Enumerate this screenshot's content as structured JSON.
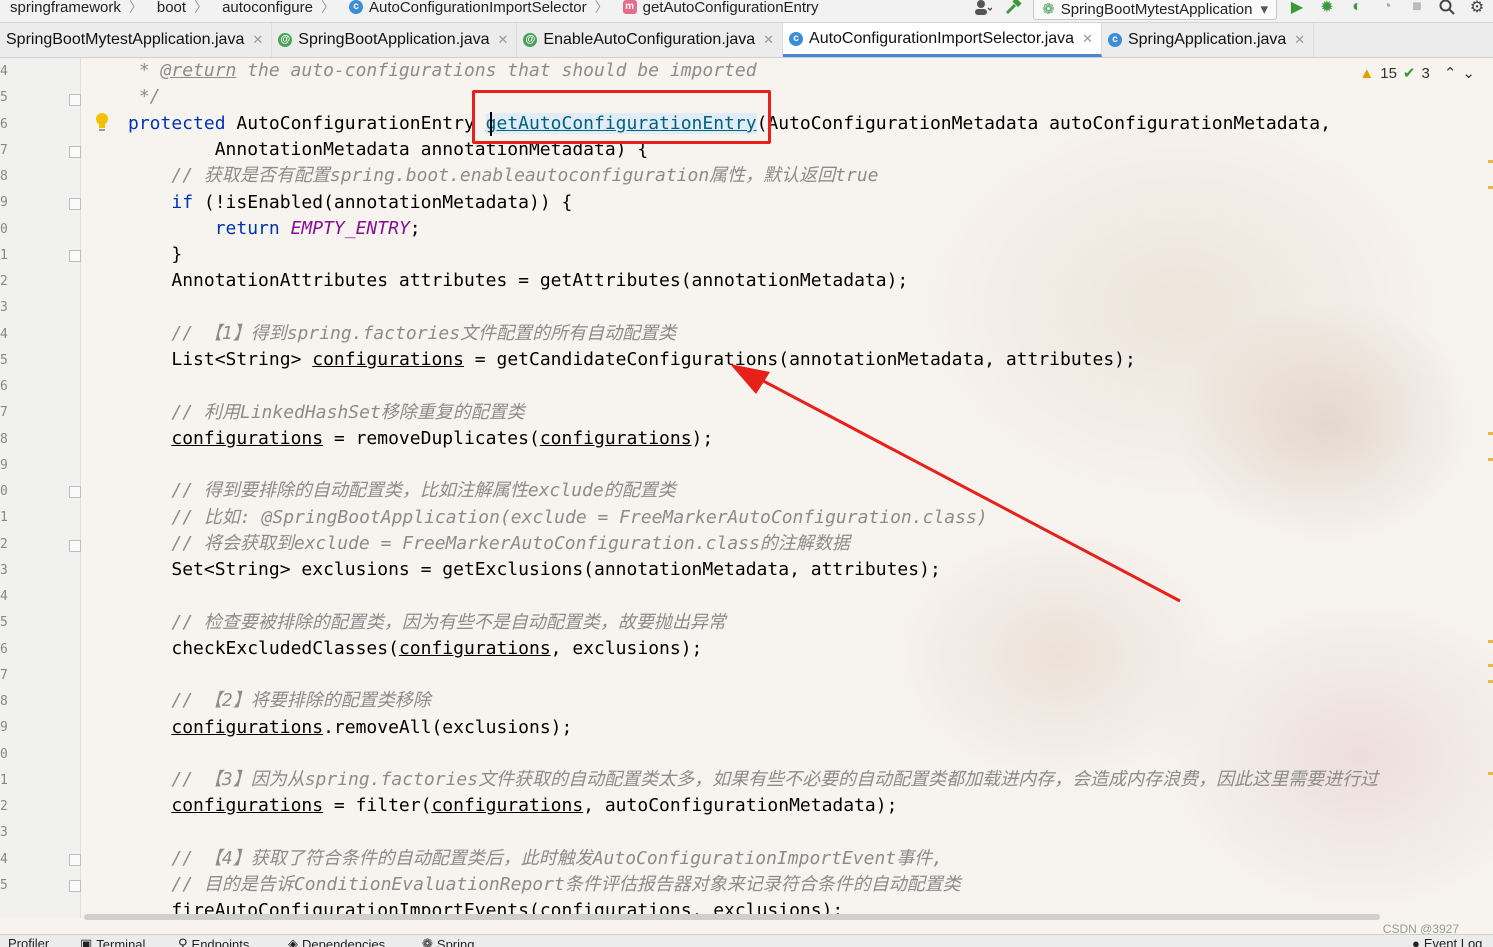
{
  "breadcrumb": [
    {
      "label": "springframework",
      "icon": null
    },
    {
      "label": "boot",
      "icon": null
    },
    {
      "label": "autoconfigure",
      "icon": null
    },
    {
      "label": "AutoConfigurationImportSelector",
      "icon": "class-icon"
    },
    {
      "label": "getAutoConfigurationEntry",
      "icon": "method-icon"
    }
  ],
  "toolbar": {
    "run_config": "SpringBootMytestApplication"
  },
  "tabs": [
    {
      "label": "SpringBootMytestApplication.java",
      "icon": "none",
      "active": false
    },
    {
      "label": "SpringBootApplication.java",
      "icon": "annotation-icon",
      "active": false
    },
    {
      "label": "EnableAutoConfiguration.java",
      "icon": "annotation-icon",
      "active": false
    },
    {
      "label": "AutoConfigurationImportSelector.java",
      "icon": "class-icon",
      "active": true
    },
    {
      "label": "SpringApplication.java",
      "icon": "class-icon",
      "active": false
    }
  ],
  "inspections": {
    "warnings": "15",
    "checks": "3"
  },
  "gutter_numbers": [
    "4",
    "5",
    "6",
    "7",
    "8",
    "9",
    "0",
    "1",
    "2",
    "3",
    "4",
    "5",
    "6",
    "7",
    "8",
    "9",
    "0",
    "1",
    "2",
    "3",
    "4",
    "5",
    "6",
    "7",
    "8",
    "9",
    "0",
    "1",
    "2",
    "3",
    "4",
    "5"
  ],
  "code": {
    "l1_tag": "@return",
    "l1_text": " the auto-configurations that should be imported",
    "l2": "*/",
    "l3_kw": "protected",
    "l3_type": " AutoConfigurationEntry ",
    "l3_method": "getAutoConfigurationEntry",
    "l3_rest": "(AutoConfigurationMetadata autoConfigurationMetadata,",
    "l4": "AnnotationMetadata annotationMetadata) {",
    "l5": "// 获取是否有配置spring.boot.enableautoconfiguration属性，默认返回true",
    "l6_kw": "if",
    "l6_rest": " (!isEnabled(annotationMetadata)) {",
    "l7_kw": "return",
    "l7_const": "EMPTY_ENTRY",
    "l7_end": ";",
    "l8": "}",
    "l9": "AnnotationAttributes attributes = getAttributes(annotationMetadata);",
    "l11": "// 【1】得到spring.factories文件配置的所有自动配置类",
    "l12_a": "List<String> ",
    "l12_var": "configurations",
    "l12_b": " = getCandidateConfigurations(annotationMetadata, attributes);",
    "l14": "// 利用LinkedHashSet移除重复的配置类",
    "l15_var": "configurations",
    "l15_b": " = removeDuplicates(",
    "l15_var2": "configurations",
    "l15_c": ");",
    "l17": "// 得到要排除的自动配置类，比如注解属性exclude的配置类",
    "l18": "// 比如: @SpringBootApplication(exclude = FreeMarkerAutoConfiguration.class)",
    "l19": "// 将会获取到exclude = FreeMarkerAutoConfiguration.class的注解数据",
    "l20": "Set<String> exclusions = getExclusions(annotationMetadata, attributes);",
    "l22": "// 检查要被排除的配置类，因为有些不是自动配置类，故要抛出异常",
    "l23_a": "checkExcludedClasses(",
    "l23_var": "configurations",
    "l23_b": ", exclusions);",
    "l25": "// 【2】将要排除的配置类移除",
    "l26_var": "configurations",
    "l26_b": ".removeAll(exclusions);",
    "l28": "// 【3】因为从spring.factories文件获取的自动配置类太多，如果有些不必要的自动配置类都加载进内存，会造成内存浪费，因此这里需要进行过",
    "l29_var": "configurations",
    "l29_b": " = filter(",
    "l29_var2": "configurations",
    "l29_c": ", autoConfigurationMetadata);",
    "l31": "// 【4】获取了符合条件的自动配置类后，此时触发AutoConfigurationImportEvent事件,",
    "l32": "// 目的是告诉ConditionEvaluationReport条件评估报告器对象来记录符合条件的自动配置类",
    "l33_a": "fireAutoConfigurationImportEvents(",
    "l33_var": "configurations",
    "l33_b": ", exclusions);"
  },
  "bottom_tools": [
    "Profiler",
    "Terminal",
    "Endpoints",
    "Dependencies",
    "Spring",
    "Event Log"
  ],
  "watermark": "CSDN @3927",
  "colors": {
    "keyword": "#0033b3",
    "comment": "#8c8c8c",
    "annotation_red": "#e8201a",
    "constant": "#871094"
  }
}
